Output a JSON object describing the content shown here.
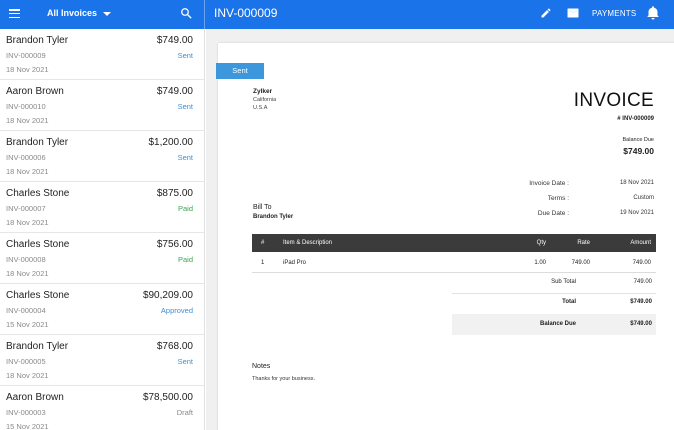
{
  "topbar": {
    "filter_label": "All Invoices",
    "title": "INV-000009",
    "payments_label": "PAYMENTS",
    "icons": [
      "menu-icon",
      "chevron-down-icon",
      "search-icon",
      "pencil-icon",
      "mail-icon",
      "bell-icon"
    ],
    "color": "#1a73e8"
  },
  "invoices": [
    {
      "name": "Brandon Tyler",
      "amount": "$749.00",
      "number": "INV-000009",
      "status": "Sent",
      "status_color": "#3d8fd6",
      "date": "18 Nov 2021"
    },
    {
      "name": "Aaron Brown",
      "amount": "$749.00",
      "number": "INV-000010",
      "status": "Sent",
      "status_color": "#3d8fd6",
      "date": "18 Nov 2021"
    },
    {
      "name": "Brandon Tyler",
      "amount": "$1,200.00",
      "number": "INV-000006",
      "status": "Sent",
      "status_color": "#3d8fd6",
      "date": "18 Nov 2021"
    },
    {
      "name": "Charles Stone",
      "amount": "$875.00",
      "number": "INV-000007",
      "status": "Paid",
      "status_color": "#3aa655",
      "date": "18 Nov 2021"
    },
    {
      "name": "Charles Stone",
      "amount": "$756.00",
      "number": "INV-000008",
      "status": "Paid",
      "status_color": "#3aa655",
      "date": "18 Nov 2021"
    },
    {
      "name": "Charles Stone",
      "amount": "$90,209.00",
      "number": "INV-000004",
      "status": "Approved",
      "status_color": "#3d8fd6",
      "date": "15 Nov 2021"
    },
    {
      "name": "Brandon Tyler",
      "amount": "$768.00",
      "number": "INV-000005",
      "status": "Sent",
      "status_color": "#3d8fd6",
      "date": "18 Nov 2021"
    },
    {
      "name": "Aaron Brown",
      "amount": "$78,500.00",
      "number": "INV-000003",
      "status": "Draft",
      "status_color": "#8a8a8a",
      "date": "15 Nov 2021"
    }
  ],
  "detail": {
    "ribbon": "Sent",
    "org": {
      "name": "Zylker",
      "line1": "California",
      "line2": "U.S.A"
    },
    "heading": "INVOICE",
    "number": "# INV-000009",
    "balance_due_label": "Balance Due",
    "balance_due_value": "$749.00",
    "meta": [
      {
        "label": "Invoice Date :",
        "value": "18 Nov 2021"
      },
      {
        "label": "Terms :",
        "value": "Custom"
      },
      {
        "label": "Due Date :",
        "value": "19 Nov 2021"
      }
    ],
    "bill_to_label": "Bill To",
    "bill_to_name": "Brandon Tyler",
    "table": {
      "headers": {
        "num": "#",
        "item": "Item & Description",
        "qty": "Qty",
        "rate": "Rate",
        "amount": "Amount"
      },
      "rows": [
        {
          "num": "1",
          "item": "iPad Pro",
          "qty": "1.00",
          "rate": "749.00",
          "amount": "749.00"
        }
      ]
    },
    "totals": {
      "sub_total_label": "Sub Total",
      "sub_total": "749.00",
      "total_label": "Total",
      "total": "$749.00",
      "balance_label": "Balance Due",
      "balance": "$749.00"
    },
    "notes_label": "Notes",
    "notes_text": "Thanks for your business."
  }
}
